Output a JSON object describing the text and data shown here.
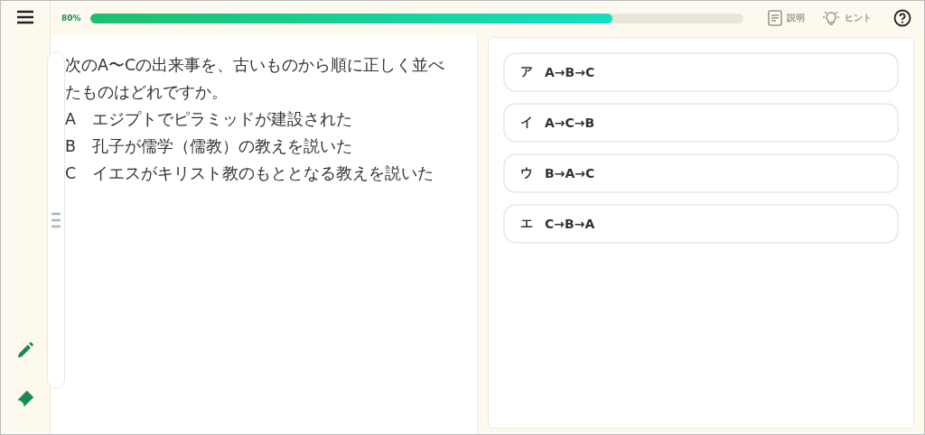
{
  "progress": {
    "label": "80%",
    "level": 0.8
  },
  "toolbar": [
    {
      "kind": "note",
      "label": "説明",
      "disabled": true
    },
    {
      "kind": "hint",
      "label": "ヒント",
      "disabled": true
    }
  ],
  "question": {
    "lines": [
      "次のA〜Cの出来事を、古いものから順に正しく並べたものはどれですか。",
      "A　エジプトでピラミッドが建設された",
      "B　孔子が儒学（儒教）の教えを説いた",
      "C　イエスがキリスト教のもととなる教えを説いた"
    ]
  },
  "choices": [
    {
      "mark": "ア",
      "text": "A→B→C",
      "selected": false
    },
    {
      "mark": "イ",
      "text": "A→C→B",
      "selected": false
    },
    {
      "mark": "ウ",
      "text": "B→A→C",
      "selected": false
    },
    {
      "mark": "エ",
      "text": "C→B→A",
      "selected": false
    }
  ],
  "tools": [
    {
      "kind": "pencil"
    },
    {
      "kind": "eraser"
    }
  ]
}
